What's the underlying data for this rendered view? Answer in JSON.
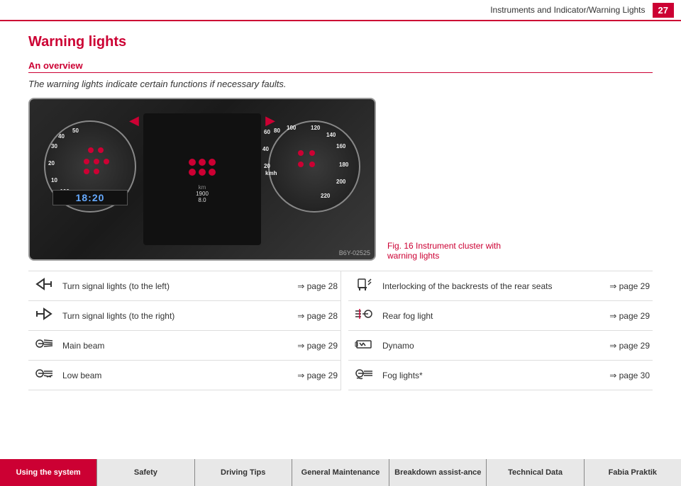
{
  "header": {
    "title": "Instruments and Indicator/Warning Lights",
    "page_number": "27"
  },
  "page": {
    "heading": "Warning lights",
    "section_title": "An overview",
    "intro": "The warning lights indicate certain functions if necessary faults.",
    "fig_caption": "Fig. 16   Instrument cluster with warning lights",
    "image_ref": "B6Y-02525"
  },
  "dashboard": {
    "time": "18:20",
    "odometer": "1900\n8.0"
  },
  "warnings_left": [
    {
      "icon_name": "turn-signal-left-icon",
      "text": "Turn signal lights (to the left)",
      "ref": "⇒ page 28"
    },
    {
      "icon_name": "turn-signal-right-icon",
      "text": "Turn signal lights (to the right)",
      "ref": "⇒ page 28"
    },
    {
      "icon_name": "main-beam-icon",
      "text": "Main beam",
      "ref": "⇒ page 29"
    },
    {
      "icon_name": "low-beam-icon",
      "text": "Low beam",
      "ref": "⇒ page 29"
    }
  ],
  "warnings_right": [
    {
      "icon_name": "seat-backrest-icon",
      "text": "Interlocking of the backrests of the rear seats",
      "ref": "⇒ page 29"
    },
    {
      "icon_name": "rear-fog-icon",
      "text": "Rear fog light",
      "ref": "⇒ page 29"
    },
    {
      "icon_name": "dynamo-icon",
      "text": "Dynamo",
      "ref": "⇒ page 29"
    },
    {
      "icon_name": "fog-lights-icon",
      "text": "Fog lights*",
      "ref": "⇒ page 30"
    }
  ],
  "bottom_nav": [
    {
      "label": "Using the system",
      "active": true
    },
    {
      "label": "Safety",
      "active": false
    },
    {
      "label": "Driving Tips",
      "active": false
    },
    {
      "label": "General Maintenance",
      "active": false
    },
    {
      "label": "Breakdown assist-ance",
      "active": false
    },
    {
      "label": "Technical Data",
      "active": false
    },
    {
      "label": "Fabia Praktik",
      "active": false
    }
  ]
}
